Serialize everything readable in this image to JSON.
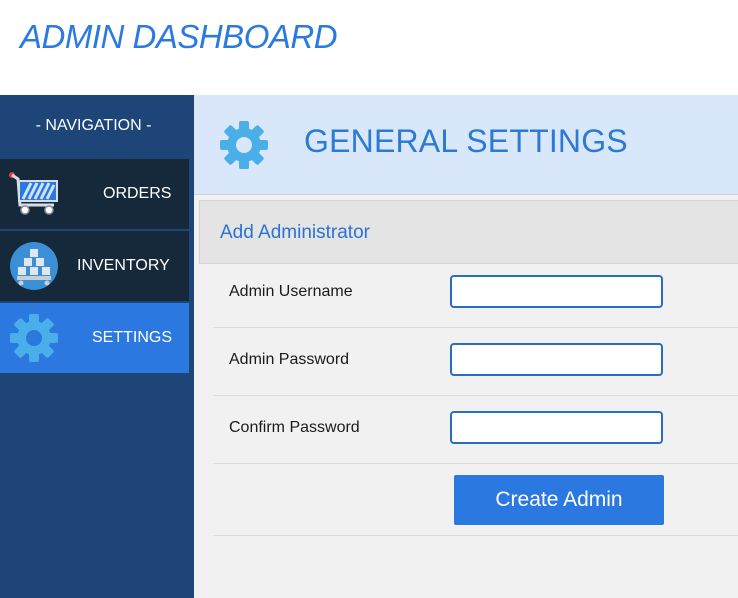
{
  "app": {
    "title": "ADMIN DASHBOARD"
  },
  "sidebar": {
    "heading": "- NAVIGATION -",
    "items": [
      {
        "label": "ORDERS",
        "icon": "shopping-cart-icon",
        "active": false
      },
      {
        "label": "INVENTORY",
        "icon": "inventory-boxes-icon",
        "active": false
      },
      {
        "label": "SETTINGS",
        "icon": "gear-icon",
        "active": true
      }
    ]
  },
  "header": {
    "title": "GENERAL SETTINGS",
    "icon": "gear-icon"
  },
  "section": {
    "title": "Add Administrator"
  },
  "form": {
    "fields": [
      {
        "label": "Admin Username",
        "value": ""
      },
      {
        "label": "Admin Password",
        "value": ""
      },
      {
        "label": "Confirm Password",
        "value": ""
      }
    ],
    "submit_label": "Create Admin"
  },
  "colors": {
    "accent": "#2b79e0",
    "sidebar": "#1d4577",
    "nav_item": "#16293a",
    "header_bg": "#d9e7fb",
    "gear": "#4aaee8"
  }
}
